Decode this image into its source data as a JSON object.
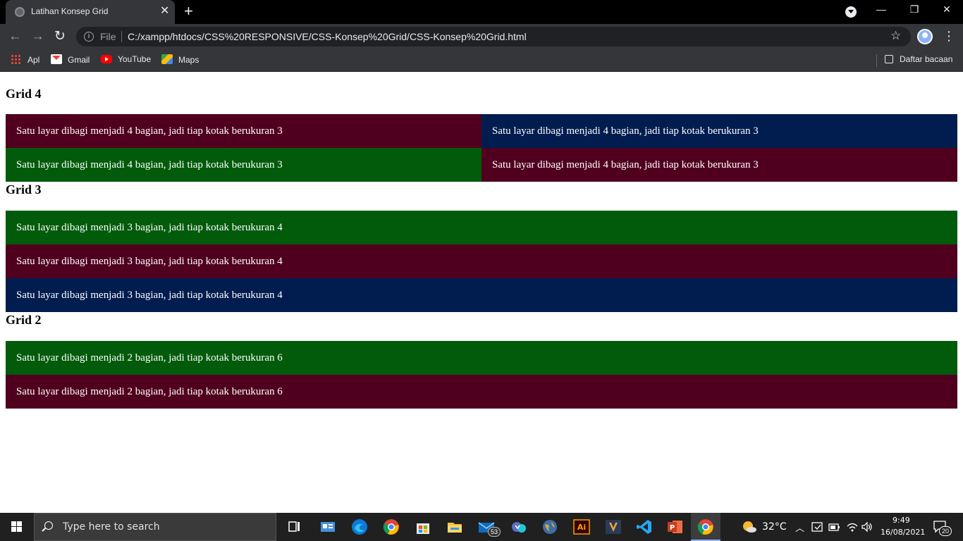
{
  "browser": {
    "tab_title": "Latihan Konsep Grid",
    "tab_close": "✕",
    "new_tab": "+",
    "window_controls": {
      "minimize": "—",
      "restore": "❐",
      "close": "✕"
    },
    "nav": {
      "back": "←",
      "forward": "→",
      "reload": "↻"
    },
    "address": {
      "info": "i",
      "scheme_label": "File",
      "url": "C:/xampp/htdocs/CSS%20RESPONSIVE/CSS-Konsep%20Grid/CSS-Konsep%20Grid.html"
    },
    "star": "☆",
    "menu": "⋮",
    "bookmarks": [
      {
        "label": "Apl",
        "icon": "apps-icon"
      },
      {
        "label": "Gmail",
        "icon": "gmail-icon"
      },
      {
        "label": "YouTube",
        "icon": "youtube-icon"
      },
      {
        "label": "Maps",
        "icon": "maps-icon"
      }
    ],
    "reading_list": "Daftar bacaan"
  },
  "page": {
    "sections": [
      {
        "heading": "Grid 4",
        "cells": [
          {
            "text": "Satu layar dibagi menjadi 4 bagian, jadi tiap kotak berukuran 3",
            "color": "#50001e"
          },
          {
            "text": "Satu layar dibagi menjadi 4 bagian, jadi tiap kotak berukuran 3",
            "color": "#011d4f"
          },
          {
            "text": "Satu layar dibagi menjadi 4 bagian, jadi tiap kotak berukuran 3",
            "color": "#015b0b"
          },
          {
            "text": "Satu layar dibagi menjadi 4 bagian, jadi tiap kotak berukuran 3",
            "color": "#50001e"
          }
        ]
      },
      {
        "heading": "Grid 3",
        "cells": [
          {
            "text": "Satu layar dibagi menjadi 3 bagian, jadi tiap kotak berukuran 4",
            "color": "#015b0b"
          },
          {
            "text": "Satu layar dibagi menjadi 3 bagian, jadi tiap kotak berukuran 4",
            "color": "#50001e"
          },
          {
            "text": "Satu layar dibagi menjadi 3 bagian, jadi tiap kotak berukuran 4",
            "color": "#011d4f"
          }
        ]
      },
      {
        "heading": "Grid 2",
        "cells": [
          {
            "text": "Satu layar dibagi menjadi 2 bagian, jadi tiap kotak berukuran 6",
            "color": "#015b0b"
          },
          {
            "text": "Satu layar dibagi menjadi 2 bagian, jadi tiap kotak berukuran 6",
            "color": "#50001e"
          }
        ]
      }
    ]
  },
  "taskbar": {
    "search_placeholder": "Type here to search",
    "mail_badge": "53",
    "weather": "32°C",
    "time": "9:49",
    "date": "16/08/2021",
    "notifications": "20"
  }
}
